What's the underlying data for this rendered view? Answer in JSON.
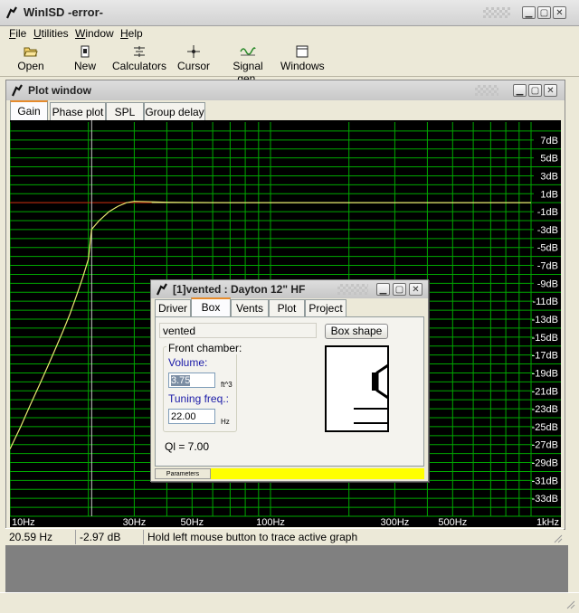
{
  "app": {
    "title": "WinISD -error-"
  },
  "menu": [
    {
      "accel": "F",
      "rest": "ile"
    },
    {
      "accel": "U",
      "rest": "tilities"
    },
    {
      "accel": "W",
      "rest": "indow"
    },
    {
      "accel": "H",
      "rest": "elp"
    }
  ],
  "toolbar": [
    {
      "label": "Open",
      "icon": "folder-open-icon"
    },
    {
      "label": "New",
      "icon": "new-document-icon"
    },
    {
      "label": "Calculators",
      "icon": "calculator-icon"
    },
    {
      "label": "Cursor",
      "icon": "crosshair-icon"
    },
    {
      "label": "Signal gen.",
      "icon": "sine-wave-icon"
    },
    {
      "label": "Windows",
      "icon": "window-icon"
    }
  ],
  "plot_window": {
    "title": "Plot window",
    "tabs": [
      "Gain",
      "Phase plot",
      "SPL",
      "Group delay"
    ],
    "active_tab": "Gain"
  },
  "chart_data": {
    "type": "line",
    "x_scale": "log",
    "xlim": [
      10,
      1000
    ],
    "ylim": [
      -35,
      9
    ],
    "x_ticks": [
      {
        "value": 10,
        "label": "10Hz"
      },
      {
        "value": 30,
        "label": "30Hz"
      },
      {
        "value": 50,
        "label": "50Hz"
      },
      {
        "value": 100,
        "label": "100Hz"
      },
      {
        "value": 300,
        "label": "300Hz"
      },
      {
        "value": 500,
        "label": "500Hz"
      },
      {
        "value": 1000,
        "label": "1kHz"
      }
    ],
    "y_ticks": [
      {
        "value": 7,
        "label": "7dB"
      },
      {
        "value": 5,
        "label": "5dB"
      },
      {
        "value": 3,
        "label": "3dB"
      },
      {
        "value": 1,
        "label": "1dB"
      },
      {
        "value": -1,
        "label": "-1dB"
      },
      {
        "value": -3,
        "label": "-3dB"
      },
      {
        "value": -5,
        "label": "-5dB"
      },
      {
        "value": -7,
        "label": "-7dB"
      },
      {
        "value": -9,
        "label": "-9dB"
      },
      {
        "value": -11,
        "label": "-11dB"
      },
      {
        "value": -13,
        "label": "-13dB"
      },
      {
        "value": -15,
        "label": "-15dB"
      },
      {
        "value": -17,
        "label": "-17dB"
      },
      {
        "value": -19,
        "label": "-19dB"
      },
      {
        "value": -21,
        "label": "-21dB"
      },
      {
        "value": -23,
        "label": "-23dB"
      },
      {
        "value": -25,
        "label": "-25dB"
      },
      {
        "value": -27,
        "label": "-27dB"
      },
      {
        "value": -29,
        "label": "-29dB"
      },
      {
        "value": -31,
        "label": "-31dB"
      },
      {
        "value": -33,
        "label": "-33dB"
      }
    ],
    "grid": true,
    "cursor": {
      "x": 20.59,
      "y": -2.97
    },
    "reference_line": {
      "y": 0
    },
    "series": [
      {
        "color": "#e8e870",
        "points": [
          [
            10,
            -27.5
          ],
          [
            11,
            -25
          ],
          [
            12,
            -22.5
          ],
          [
            13,
            -20.3
          ],
          [
            14,
            -18.2
          ],
          [
            15,
            -16.2
          ],
          [
            16,
            -14.3
          ],
          [
            17,
            -12.4
          ],
          [
            18,
            -10.4
          ],
          [
            19,
            -8.4
          ],
          [
            20,
            -6.3
          ],
          [
            20.59,
            -2.97
          ],
          [
            22,
            -2.0
          ],
          [
            24,
            -1.0
          ],
          [
            26,
            -0.4
          ],
          [
            28,
            0.0
          ],
          [
            30,
            0.15
          ],
          [
            35,
            0.1
          ],
          [
            40,
            0.05
          ],
          [
            50,
            0.02
          ],
          [
            70,
            0.0
          ],
          [
            90,
            0.0
          ],
          [
            1000,
            0.0
          ]
        ]
      }
    ],
    "colors": {
      "background": "#000000",
      "grid": "#00a800",
      "curve": "#e8e870",
      "reference": "#d01010",
      "cursor": "#c8c8c8",
      "label": "#ffffff"
    }
  },
  "statusbar": {
    "freq": "20.59 Hz",
    "gain": "-2.97 dB",
    "hint": "Hold left mouse button to trace active graph"
  },
  "dialog": {
    "title": "[1]vented : Dayton 12\" HF",
    "tabs": [
      "Driver",
      "Box",
      "Vents",
      "Plot",
      "Project"
    ],
    "active_tab": "Box",
    "box_type": "vented",
    "box_shape_button": "Box shape",
    "front_chamber_label": "Front chamber:",
    "volume_label": "Volume:",
    "volume_value": "3.75",
    "volume_unit": "ft^3",
    "tuning_label": "Tuning freq.:",
    "tuning_value": "22.00",
    "tuning_unit": "Hz",
    "ql_text": "Ql = 7.00",
    "params_label": "Parameters",
    "warning_color": "#ffff00"
  }
}
